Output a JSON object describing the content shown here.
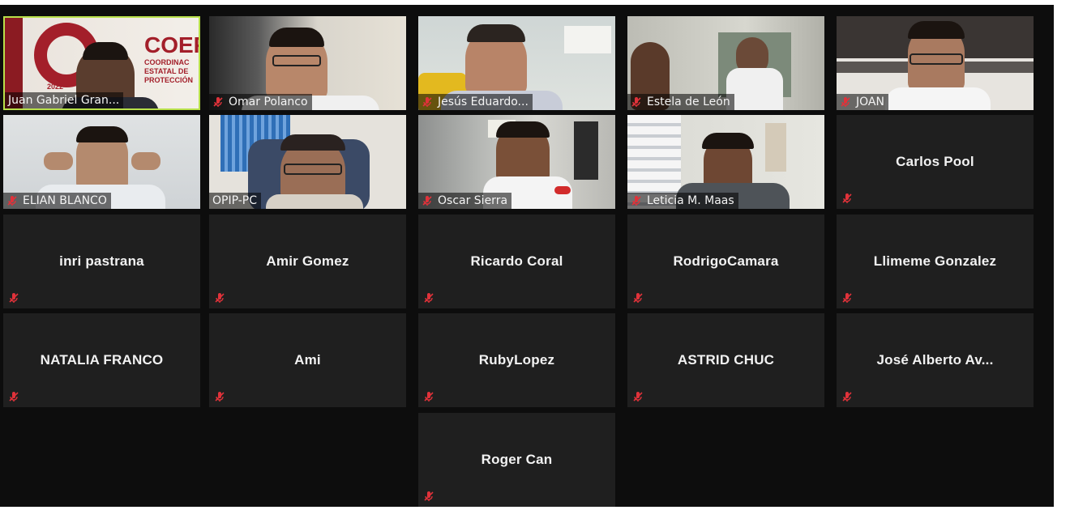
{
  "meeting": {
    "participants": [
      {
        "name": "Juan Gabriel Gran...",
        "video": true,
        "muted": false,
        "active": true
      },
      {
        "name": "Omar Polanco",
        "video": true,
        "muted": true
      },
      {
        "name": "Jesús Eduardo...",
        "video": true,
        "muted": true
      },
      {
        "name": "Estela de León",
        "video": true,
        "muted": true
      },
      {
        "name": "JOAN",
        "video": true,
        "muted": true
      },
      {
        "name": "ELIAN BLANCO",
        "video": true,
        "muted": true
      },
      {
        "name": "OPIP-PC",
        "video": true,
        "muted": false
      },
      {
        "name": "Oscar Sierra",
        "video": true,
        "muted": true
      },
      {
        "name": "Leticia M. Maas",
        "video": true,
        "muted": true
      },
      {
        "name": "Carlos Pool",
        "video": false,
        "muted": true
      },
      {
        "name": "inri pastrana",
        "video": false,
        "muted": true
      },
      {
        "name": "Amir Gomez",
        "video": false,
        "muted": true
      },
      {
        "name": "Ricardo Coral",
        "video": false,
        "muted": true
      },
      {
        "name": "RodrigoCamara",
        "video": false,
        "muted": true
      },
      {
        "name": "Llimeme Gonzalez",
        "video": false,
        "muted": true
      },
      {
        "name": "NATALIA FRANCO",
        "video": false,
        "muted": true
      },
      {
        "name": "Ami",
        "video": false,
        "muted": true
      },
      {
        "name": "RubyLopez",
        "video": false,
        "muted": true
      },
      {
        "name": "ASTRID CHUC",
        "video": false,
        "muted": true
      },
      {
        "name": "José Alberto Av...",
        "video": false,
        "muted": true
      },
      {
        "name": "Roger Can",
        "video": false,
        "muted": true
      }
    ],
    "banner": {
      "logo_text": "COEP",
      "line1": "COORDINAC",
      "line2": "ESTATAL DE",
      "line3": "PROTECCIÓN",
      "year": "2022"
    }
  },
  "colors": {
    "background": "#0d0d0d",
    "tile": "#1f1f1f",
    "muted_icon": "#e0323a",
    "active_border": "#b8e04a",
    "name_text": "#f2f2f2"
  }
}
